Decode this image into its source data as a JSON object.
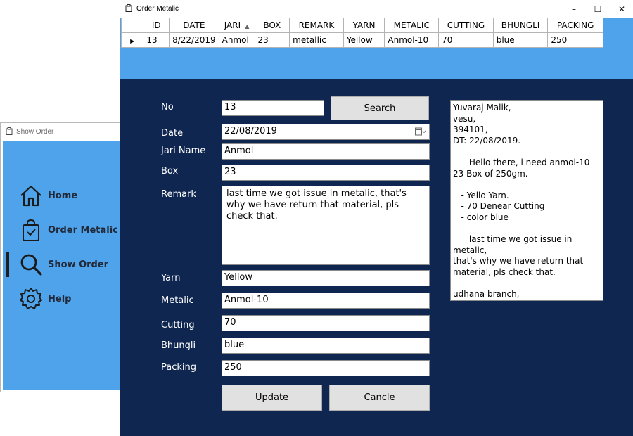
{
  "back_window": {
    "title": "Show Order",
    "nav": [
      {
        "label": "Home",
        "icon": "home-icon"
      },
      {
        "label": "Order Metalic",
        "icon": "shopping-bag-icon"
      },
      {
        "label": "Show Order",
        "icon": "search-icon",
        "active": true
      },
      {
        "label": "Help",
        "icon": "gear-icon"
      }
    ]
  },
  "front_window": {
    "title": "Order Metalic",
    "controls": {
      "minimize": "–",
      "maximize": "☐",
      "close": "✕"
    }
  },
  "grid": {
    "columns": [
      "ID",
      "DATE",
      "JARI",
      "BOX",
      "REMARK",
      "YARN",
      "METALIC",
      "CUTTING",
      "BHUNGLI",
      "PACKING"
    ],
    "sorted_column": "JARI",
    "rows": [
      [
        "13",
        "8/22/2019",
        "Anmol",
        "23",
        "metallic",
        "Yellow",
        "Anmol-10",
        "70",
        "blue",
        "250"
      ]
    ]
  },
  "form": {
    "no_label": "No",
    "no_value": "13",
    "search_label": "Search",
    "date_label": "Date",
    "date_value": "22/08/2019",
    "jari_label": "Jari Name",
    "jari_value": "Anmol",
    "box_label": "Box",
    "box_value": "23",
    "remark_label": "Remark",
    "remark_value": "last time we got issue in metalic, that's why we have return that material, pls check that.",
    "yarn_label": "Yarn",
    "yarn_value": "Yellow",
    "metalic_label": "Metalic",
    "metalic_value": "Anmol-10",
    "cutting_label": "Cutting",
    "cutting_value": "70",
    "bhungli_label": "Bhungli",
    "bhungli_value": "blue",
    "packing_label": "Packing",
    "packing_value": "250",
    "update_label": "Update",
    "cancel_label": "Cancle"
  },
  "letter": {
    "text": "Yuvaraj Malik,\nvesu,\n394101,\nDT: 22/08/2019.\n\n      Hello there, i need anmol-10\n23 Box of 250gm.\n\n   - Yello Yarn.\n   - 70 Denear Cutting\n   - color blue\n\n      last time we got issue in metalic,\nthat's why we have return that\nmaterial, pls check that.\n\nudhana branch,\nAksharlon Jari."
  },
  "colors": {
    "sidebar": "#4fa3ea",
    "form_background": "#0f2650",
    "button": "#e1e1e1"
  }
}
